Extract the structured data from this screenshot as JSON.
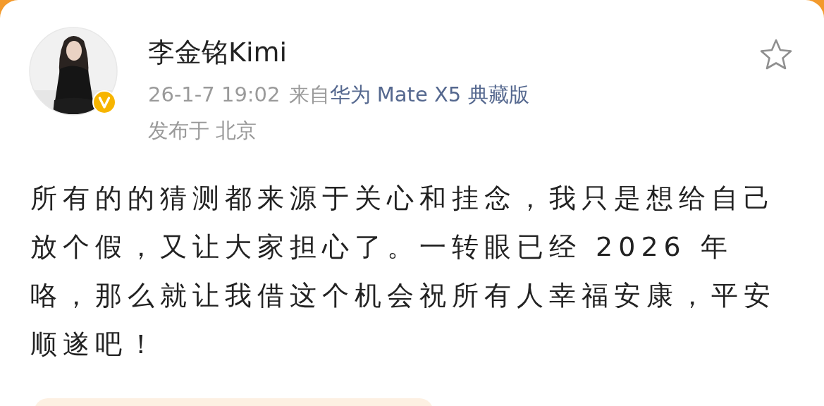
{
  "post": {
    "author": {
      "name": "李金铭Kimi",
      "verified": true
    },
    "time": "26-1-7 19:02",
    "source_prefix": "来自",
    "source_device": "华为 Mate X5 典藏版",
    "location": "发布于 北京",
    "favorited": false,
    "text": "所有的的猜测都来源于关心和挂念，我只是想给自己放个假，又让大家担心了。一转眼已经 2026 年咯，那么就让我借这个机会祝所有人幸福安康，平安顺遂吧！"
  }
}
